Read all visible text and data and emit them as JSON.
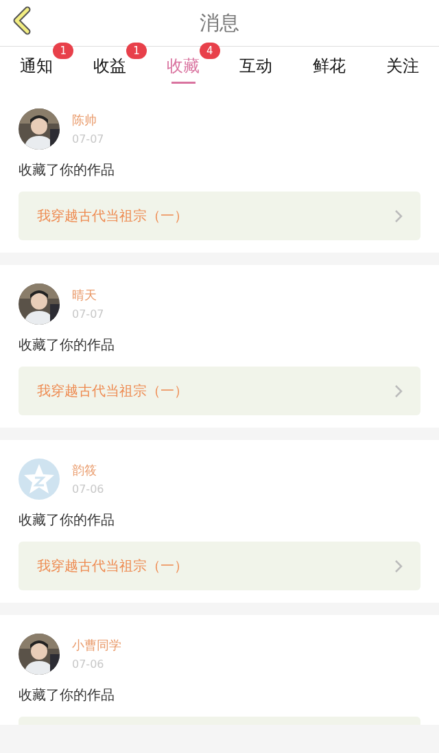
{
  "header": {
    "title": "消息"
  },
  "tabs": [
    {
      "label": "通知",
      "badge": "1",
      "selected": false
    },
    {
      "label": "收益",
      "badge": "1",
      "selected": false
    },
    {
      "label": "收藏",
      "badge": "4",
      "selected": true
    },
    {
      "label": "互动",
      "selected": false
    },
    {
      "label": "鲜花",
      "selected": false
    },
    {
      "label": "关注",
      "selected": false
    }
  ],
  "messages": [
    {
      "name": "陈帅",
      "date": "07-07",
      "text": "收藏了你的作品",
      "work": "我穿越古代当祖宗（一）"
    },
    {
      "name": "晴天",
      "date": "07-07",
      "text": "收藏了你的作品",
      "work": "我穿越古代当祖宗（一）"
    },
    {
      "avatar": {
        "kind": "default"
      },
      "name": "韵筱",
      "date": "07-06",
      "text": "收藏了你的作品",
      "work": "我穿越古代当祖宗（一）"
    },
    {
      "name": "小曹同学",
      "date": "07-06",
      "text": "收藏了你的作品"
    }
  ]
}
